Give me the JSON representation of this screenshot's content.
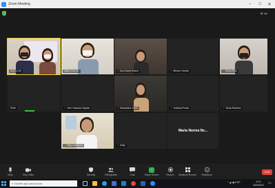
{
  "window": {
    "title": "Zoom Meeting",
    "minimize_glyph": "–",
    "maximize_glyph": "□",
    "close_glyph": "✕"
  },
  "stage": {
    "view_toggle": "⊞ Vie",
    "participants": [
      {
        "id": "p1",
        "label": "Ana Liz B.",
        "muted": false
      },
      {
        "id": "p2",
        "label": "Nelly Cruz M.",
        "muted": false
      },
      {
        "id": "p3",
        "label": "Ana Maria Bravo",
        "muted": true
      },
      {
        "id": "p4",
        "label": "Wilmer Ocaña",
        "muted": true
      },
      {
        "id": "p5",
        "label": "Silvia Ruiz",
        "muted": true
      },
      {
        "id": "p6",
        "label": "Ruth",
        "muted": false
      },
      {
        "id": "p7",
        "label": "Yeni Yolanda Zapata",
        "muted": true
      },
      {
        "id": "p8",
        "label": "Samantha Jeniz",
        "muted": true
      },
      {
        "id": "p9",
        "label": "Yudiana Pulas",
        "muted": true
      },
      {
        "id": "p10",
        "label": "Tania Ramirez",
        "muted": true
      },
      {
        "id": "p11",
        "label": "Paty Calderon",
        "muted": true
      },
      {
        "id": "p12",
        "label": "Zelly",
        "muted": true
      },
      {
        "id": "p13",
        "label": "Maria Norma Ne...",
        "muted": false
      }
    ]
  },
  "controls": {
    "mute": {
      "label": "Mute",
      "icon": "microphone-icon"
    },
    "video": {
      "label": "Stop Video",
      "icon": "video-camera-icon"
    },
    "security": {
      "label": "Security",
      "icon": "shield-icon"
    },
    "participants": {
      "label": "Participants",
      "icon": "people-icon",
      "count": "13"
    },
    "chat": {
      "label": "Chat",
      "icon": "chat-bubble-icon"
    },
    "share": {
      "label": "Share Screen",
      "icon": "share-screen-icon"
    },
    "record": {
      "label": "Record",
      "icon": "record-icon"
    },
    "breakout": {
      "label": "Breakout Rooms",
      "icon": "breakout-rooms-icon"
    },
    "reactions": {
      "label": "Reactions",
      "icon": "smiley-icon"
    },
    "end": {
      "label": "End"
    }
  },
  "taskbar": {
    "search_placeholder": "Escribe aquí para buscar",
    "tray_text": "^ ◢ ◀) ESP",
    "time": "11:01",
    "date": "30/06/2021",
    "accent": "#3fa9f5"
  }
}
